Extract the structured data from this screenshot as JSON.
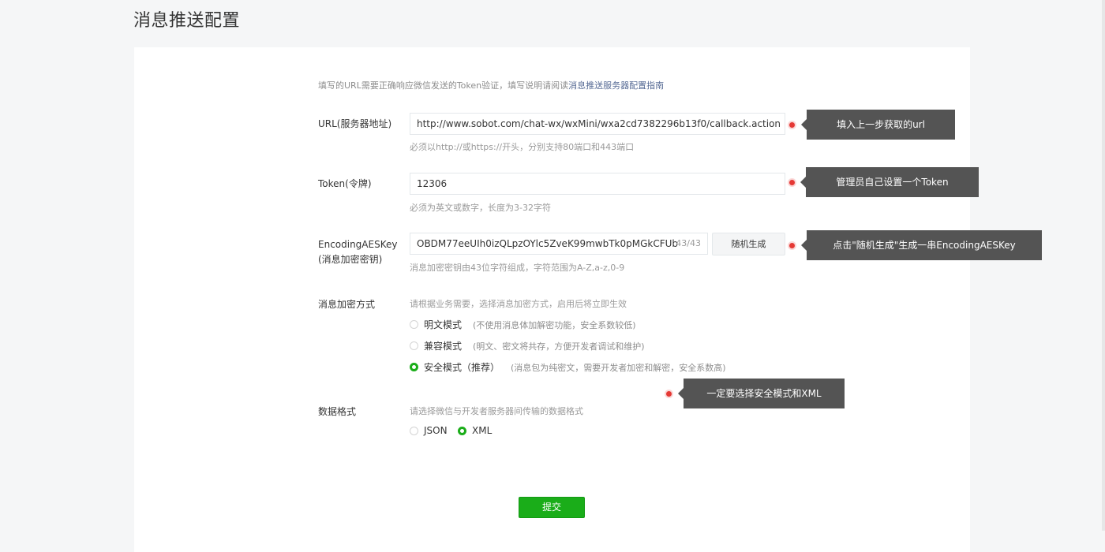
{
  "page": {
    "title": "消息推送配置"
  },
  "tip": {
    "text": "填写的URL需要正确响应微信发送的Token验证，填写说明请阅读",
    "link": "消息推送服务器配置指南"
  },
  "form": {
    "url": {
      "label": "URL(服务器地址)",
      "value": "http://www.sobot.com/chat-wx/wxMini/wxa2cd7382296b13f0/callback.action",
      "hint": "必须以http://或https://开头，分别支持80端口和443端口"
    },
    "token": {
      "label": "Token(令牌)",
      "value": "12306",
      "hint": "必须为英文或数字，长度为3-32字符"
    },
    "aeskey": {
      "label_line1": "EncodingAESKey",
      "label_line2": "(消息加密密钥)",
      "value": "OBDM77eeUIh0izQLpzOYlc5ZveK99mwbTk0pMGkCFUb",
      "counter": "43/43",
      "random_button": "随机生成",
      "hint": "消息加密密钥由43位字符组成，字符范围为A-Z,a-z,0-9"
    },
    "encryption": {
      "label": "消息加密方式",
      "hint": "请根据业务需要，选择消息加密方式，启用后将立即生效",
      "options": [
        {
          "label": "明文模式",
          "desc": "(不使用消息体加解密功能，安全系数较低)",
          "checked": false
        },
        {
          "label": "兼容模式",
          "desc": "(明文、密文将共存，方便开发者调试和维护)",
          "checked": false
        },
        {
          "label": "安全模式（推荐）",
          "desc": "(消息包为纯密文，需要开发者加密和解密，安全系数高)",
          "checked": true
        }
      ]
    },
    "format": {
      "label": "数据格式",
      "hint": "请选择微信与开发者服务器间传输的数据格式",
      "options": [
        {
          "label": "JSON",
          "checked": false
        },
        {
          "label": "XML",
          "checked": true
        }
      ]
    },
    "submit": "提交"
  },
  "callouts": {
    "url": "填入上一步获取的url",
    "token": "管理员自己设置一个Token",
    "aeskey": "点击\"随机生成\"生成一串EncodingAESKey",
    "mode": "一定要选择安全模式和XML"
  },
  "colors": {
    "primary": "#1aad19",
    "callout_bg": "#545454",
    "marker": "#e53935",
    "link": "#576b95"
  }
}
